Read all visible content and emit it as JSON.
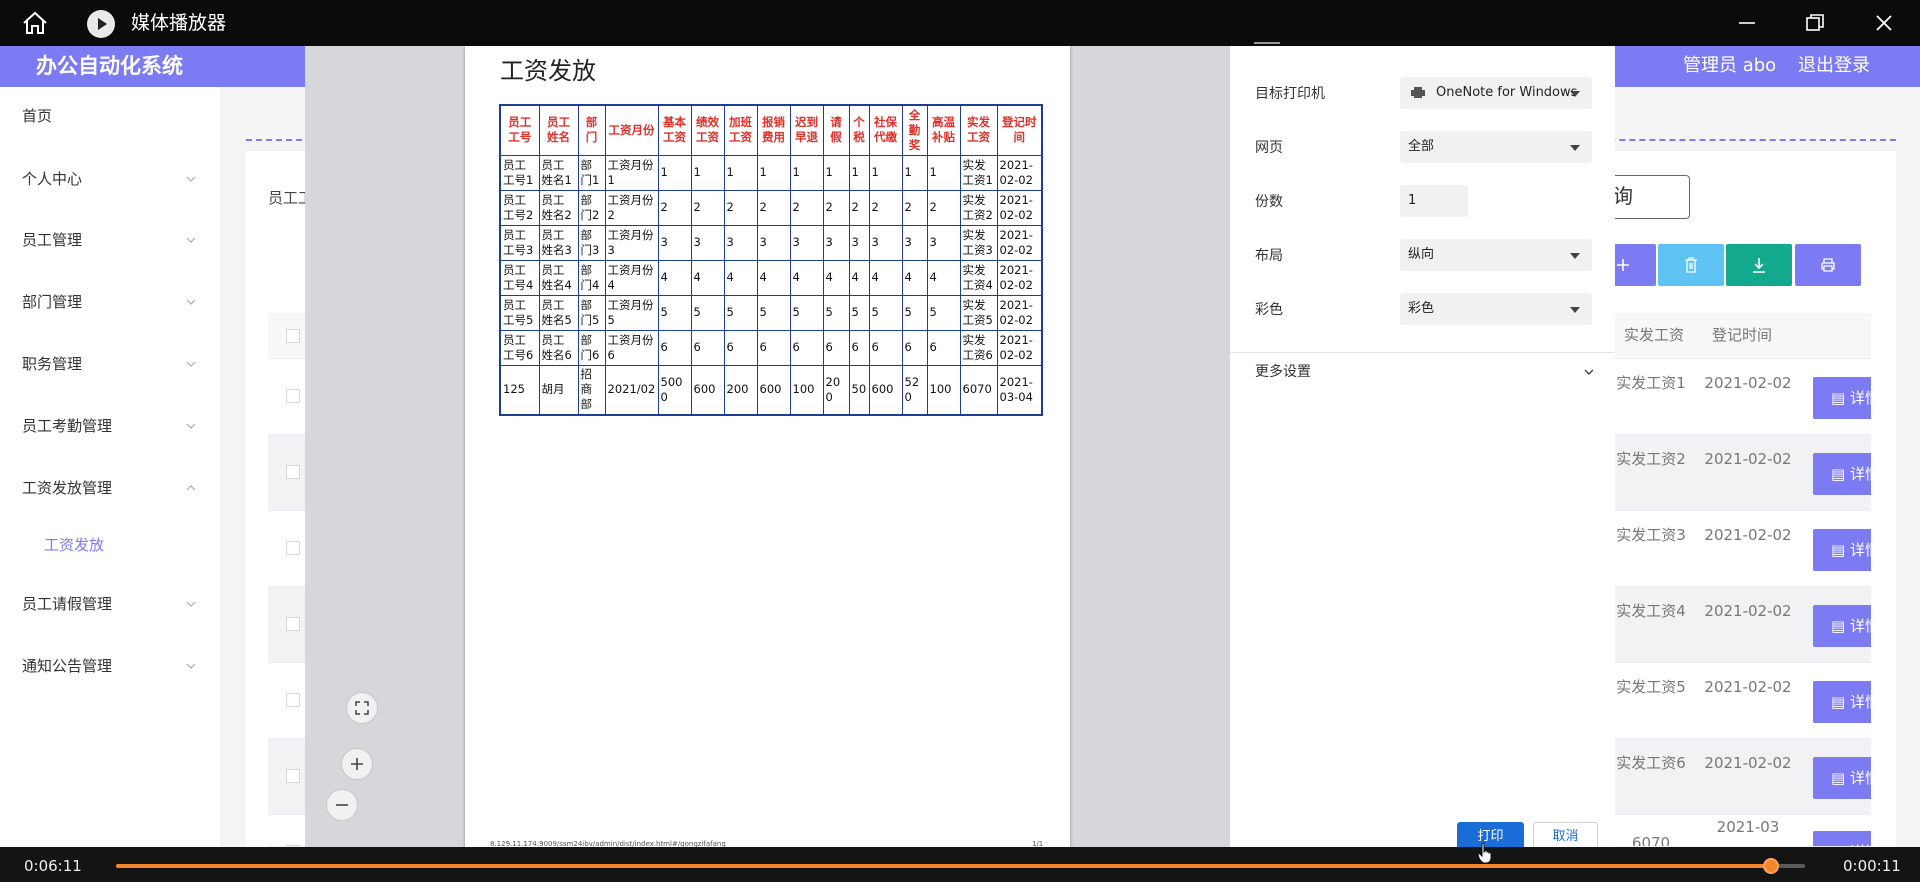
{
  "player": {
    "title": "媒体播放器",
    "time_elapsed": "0:06:11",
    "time_remaining": "0:00:11",
    "progress": 0.98
  },
  "app": {
    "brand": "办公自动化系统",
    "admin": "管理员 abo",
    "logout": "退出登录"
  },
  "sidebar": {
    "items": [
      {
        "label": "首页"
      },
      {
        "label": "个人中心"
      },
      {
        "label": "员工管理"
      },
      {
        "label": "部门管理"
      },
      {
        "label": "职务管理"
      },
      {
        "label": "员工考勤管理"
      },
      {
        "label": "工资发放管理"
      },
      {
        "label": "工资发放"
      },
      {
        "label": "员工请假管理"
      },
      {
        "label": "通知公告管理"
      }
    ]
  },
  "main": {
    "emp_label": "员工工",
    "query_label": "询",
    "headers": {
      "pay": "实发工资",
      "date": "登记时间"
    },
    "detail_label": "详情",
    "rows": [
      {
        "pay": "实发工资1",
        "date": "2021-02-02"
      },
      {
        "pay": "实发工资2",
        "date": "2021-02-02"
      },
      {
        "pay": "实发工资3",
        "date": "2021-02-02"
      },
      {
        "pay": "实发工资4",
        "date": "2021-02-02"
      },
      {
        "pay": "实发工资5",
        "date": "2021-02-02"
      },
      {
        "pay": "实发工资6",
        "date": "2021-02-02"
      },
      {
        "pay": "6070",
        "date": "2021-03"
      }
    ]
  },
  "preview": {
    "title": "工资发放",
    "columns": [
      "员工工号",
      "员工姓名",
      "部门",
      "工资月份",
      "基本工资",
      "绩效工资",
      "加班工资",
      "报销费用",
      "迟到早退",
      "请假",
      "个税",
      "社保代缴",
      "全勤奖",
      "高温补贴",
      "实发工资",
      "登记时间"
    ],
    "rows": [
      [
        "员工工号1",
        "员工姓名1",
        "部门1",
        "工资月份1",
        "1",
        "1",
        "1",
        "1",
        "1",
        "1",
        "1",
        "1",
        "1",
        "1",
        "实发工资1",
        "2021-02-02"
      ],
      [
        "员工工号2",
        "员工姓名2",
        "部门2",
        "工资月份2",
        "2",
        "2",
        "2",
        "2",
        "2",
        "2",
        "2",
        "2",
        "2",
        "2",
        "实发工资2",
        "2021-02-02"
      ],
      [
        "员工工号3",
        "员工姓名3",
        "部门3",
        "工资月份3",
        "3",
        "3",
        "3",
        "3",
        "3",
        "3",
        "3",
        "3",
        "3",
        "3",
        "实发工资3",
        "2021-02-02"
      ],
      [
        "员工工号4",
        "员工姓名4",
        "部门4",
        "工资月份4",
        "4",
        "4",
        "4",
        "4",
        "4",
        "4",
        "4",
        "4",
        "4",
        "4",
        "实发工资4",
        "2021-02-02"
      ],
      [
        "员工工号5",
        "员工姓名5",
        "部门5",
        "工资月份5",
        "5",
        "5",
        "5",
        "5",
        "5",
        "5",
        "5",
        "5",
        "5",
        "5",
        "实发工资5",
        "2021-02-02"
      ],
      [
        "员工工号6",
        "员工姓名6",
        "部门6",
        "工资月份6",
        "6",
        "6",
        "6",
        "6",
        "6",
        "6",
        "6",
        "6",
        "6",
        "6",
        "实发工资6",
        "2021-02-02"
      ],
      [
        "125",
        "胡月",
        "招商部",
        "2021/02",
        "5000",
        "600",
        "200",
        "600",
        "100",
        "200",
        "50",
        "600",
        "520",
        "100",
        "6070",
        "2021-03-04"
      ]
    ],
    "footer_url": "8.129.11.174:9009/ssm24ibv/admin/dist/index.html#/gongzifafang",
    "footer_page": "1/1"
  },
  "print_settings": {
    "printer_label": "目标打印机",
    "printer_value": "OneNote for Windows",
    "pages_label": "网页",
    "pages_value": "全部",
    "copies_label": "份数",
    "copies_value": "1",
    "layout_label": "布局",
    "layout_value": "纵向",
    "color_label": "彩色",
    "color_value": "彩色",
    "more_label": "更多设置",
    "print_button": "打印",
    "cancel_button": "取消"
  },
  "colors": {
    "accent": "#7c7bf3",
    "progress": "#f5862c",
    "print_button": "#1a6dd6"
  }
}
